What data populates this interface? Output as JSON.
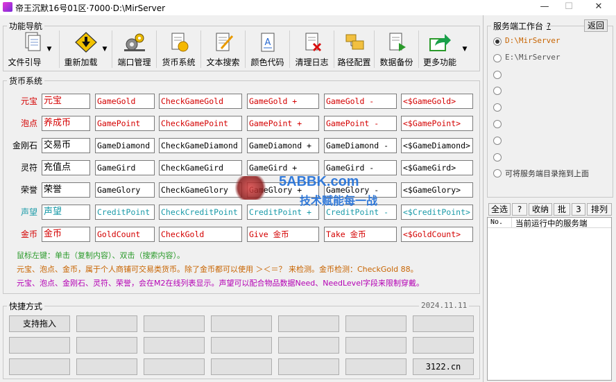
{
  "window": {
    "title": "帝王沉默16号01区·7000·D:\\MirServer",
    "minimize": "—",
    "maximize": "☐",
    "close": "✕"
  },
  "nav": {
    "title": "功能导航",
    "buttons": [
      {
        "label": "文件引导",
        "icon": "file-guide-icon",
        "dropdown": true
      },
      {
        "label": "重新加载",
        "icon": "reload-warning-icon",
        "dropdown": true
      },
      {
        "label": "端口管理",
        "icon": "port-gears-icon",
        "dropdown": false
      },
      {
        "label": "货币系统",
        "icon": "currency-icon",
        "dropdown": false
      },
      {
        "label": "文本搜索",
        "icon": "text-search-icon",
        "dropdown": false
      },
      {
        "label": "颜色代码",
        "icon": "color-code-icon",
        "dropdown": false
      },
      {
        "label": "清理日志",
        "icon": "clear-log-icon",
        "dropdown": false
      },
      {
        "label": "路径配置",
        "icon": "folder-config-icon",
        "dropdown": false
      },
      {
        "label": "数据备份",
        "icon": "backup-icon",
        "dropdown": false
      },
      {
        "label": "更多功能",
        "icon": "share-arrow-icon",
        "dropdown": true
      }
    ]
  },
  "currency": {
    "title": "货币系统",
    "rows": [
      {
        "label": "元宝",
        "name": "元宝",
        "var": "GameGold",
        "check": "CheckGameGold",
        "plus": "GameGold +",
        "minus": "GameGold -",
        "tag": "<$GameGold>",
        "color": "#d40000"
      },
      {
        "label": "泡点",
        "name": "养成币",
        "var": "GamePoint",
        "check": "CheckGamePoint",
        "plus": "GamePoint +",
        "minus": "GamePoint -",
        "tag": "<$GamePoint>",
        "color": "#d40000"
      },
      {
        "label": "金刚石",
        "name": "交易币",
        "var": "GameDiamond",
        "check": "CheckGameDiamond",
        "plus": "GameDiamond +",
        "minus": "GameDiamond -",
        "tag": "<$GameDiamond>",
        "color": "#000000"
      },
      {
        "label": "灵符",
        "name": "充值点",
        "var": "GameGird",
        "check": "CheckGameGird",
        "plus": "GameGird +",
        "minus": "GameGird -",
        "tag": "<$GameGird>",
        "color": "#000000"
      },
      {
        "label": "荣誉",
        "name": "荣誉",
        "var": "GameGlory",
        "check": "CheckGameGlory",
        "plus": "GameGlory +",
        "minus": "GameGlory -",
        "tag": "<$GameGlory>",
        "color": "#000000"
      },
      {
        "label": "声望",
        "name": "声望",
        "var": "CreditPoint",
        "check": "CheckCreditPoint",
        "plus": "CreditPoint +",
        "minus": "CreditPoint -",
        "tag": "<$CreditPoint>",
        "color": "#1a9aa8"
      },
      {
        "label": "金币",
        "name": "金币",
        "var": "GoldCount",
        "check": "CheckGold",
        "plus": "Give 金币",
        "minus": "Take 金币",
        "tag": "<$GoldCount>",
        "color": "#d40000"
      }
    ],
    "notes": [
      {
        "text": "鼠标左键：单击（复制内容）、双击（搜索内容）。",
        "color": "#2a9a2a"
      },
      {
        "text": "元宝、泡点、金币，属于个人商铺可交易类货币。除了金币都可以使用 ＞＜＝？ 来检测。金币检测：CheckGold 88。",
        "color": "#c86400"
      },
      {
        "text": "元宝、泡点、金刚石、灵符、荣誉，会在M2在线列表显示。声望可以配合物品数据Need、NeedLevel字段来限制穿戴。",
        "color": "#b400b4"
      }
    ]
  },
  "watermark": {
    "line1": "5ABBK.com",
    "line2": "技术赋能每一战"
  },
  "shortcuts": {
    "title": "快捷方式",
    "date": "2024.11.11",
    "row1": [
      "支持拖入",
      "",
      "",
      "",
      "",
      "",
      ""
    ],
    "row2": [
      "",
      "",
      "",
      "",
      "",
      "",
      ""
    ],
    "row3": [
      "",
      "",
      "",
      "",
      "",
      "",
      "3122.cn"
    ]
  },
  "side": {
    "title": "服务端工作台",
    "help": "?",
    "back": "返回",
    "options": [
      {
        "label": "D:\\MirServer",
        "selected": true,
        "color": "#c86400"
      },
      {
        "label": "E:\\MirServer",
        "selected": false,
        "color": "#555555"
      },
      {
        "label": "",
        "selected": false
      },
      {
        "label": "",
        "selected": false
      },
      {
        "label": "",
        "selected": false
      },
      {
        "label": "",
        "selected": false
      },
      {
        "label": "",
        "selected": false
      },
      {
        "label": "",
        "selected": false
      },
      {
        "label": "可将服务端目录拖到上面",
        "selected": false,
        "color": "#333333"
      }
    ],
    "buttons": [
      "全选",
      "?",
      "收纳",
      "批",
      "3",
      "排列"
    ],
    "table": {
      "col1": "No.",
      "col2": "当前运行中的服务端"
    }
  }
}
